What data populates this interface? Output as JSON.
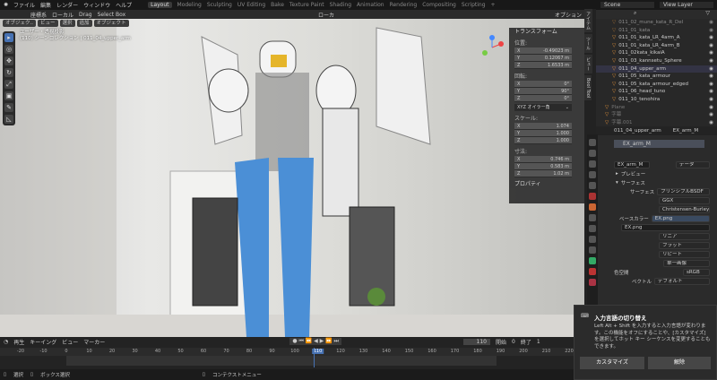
{
  "menu": [
    "ファイル",
    "編集",
    "レンダー",
    "ウィンドウ",
    "ヘルプ"
  ],
  "workspaces": [
    "Layout",
    "Modeling",
    "Sculpting",
    "UV Editing",
    "Bake",
    "Texture Paint",
    "Shading",
    "Animation",
    "Rendering",
    "Compositing",
    "Scripting",
    "+"
  ],
  "scene": "Scene",
  "view_layer": "View Layer",
  "header": {
    "orientation": "座標系",
    "pivot": "ローカル",
    "drag_label": "Drag",
    "drag_value": "Select Box",
    "snap": "ローカ",
    "options": "オプション"
  },
  "viewport": {
    "mode": "オブジェク..",
    "menus": [
      "ビュー",
      "選択",
      "追加",
      "オブジェクト"
    ],
    "view_name": "ユーザー・透視投影",
    "collection_info": "(110) シーンコレクション | 011_04_upper_arm"
  },
  "npanel": {
    "transform": "トランスフォーム",
    "location": "位置:",
    "loc": [
      "-0.49023 m",
      "0.12067 m",
      "1.6533 m"
    ],
    "rotation": "回転:",
    "rot": [
      "0°",
      "90°",
      "0°"
    ],
    "rot_mode": "XYZ オイラー角",
    "scale": "スケール:",
    "scl": [
      "1.074",
      "1.000",
      "1.000"
    ],
    "dimensions": "寸法:",
    "dim": [
      "0.746 m",
      "0.583 m",
      "1.02 m"
    ],
    "properties": "プロパティ",
    "axes": [
      "X",
      "Y",
      "Z"
    ],
    "tabs": [
      "アイテム",
      "ツール",
      "ビュー",
      "Bool Tool"
    ]
  },
  "outliner": {
    "items": [
      "011_02_mune_kata_R_Del",
      "011_01_kata",
      "011_01_kata_LR_4arm_A",
      "011_01_kata_LR_4arm_B",
      "011_02kata_kikaiA",
      "011_03_kannsetu_Sphere",
      "011_04_upper_arm",
      "011_05_kata_armour",
      "011_05_kata_armour_edged",
      "011_06_head_tuno",
      "011_10_tenohira"
    ],
    "extra": [
      "Plane",
      "字幕",
      "字幕.001"
    ]
  },
  "properties": {
    "object": "011_04_upper_arm",
    "material": "EX_arm_M",
    "slot": "EX_arm_M",
    "link": "データ",
    "preview": "プレビュー",
    "surface_section": "サーフェス",
    "surface_label": "サーフェス",
    "surface_value": "プリンシプルBSDF",
    "distribution": "GGX",
    "subsurface": "Christensen-Burley",
    "base_color_label": "ベースカラー",
    "base_color_value": "EX.png",
    "image": "EX.png",
    "interp": "リニア",
    "projection": "フラット",
    "extension": "リピート",
    "source": "単一画像",
    "colorspace_label": "色空間",
    "colorspace": "sRGB",
    "vector_label": "ベクトル",
    "vector": "デフォルト"
  },
  "timeline": {
    "menus": [
      "再生",
      "キーイング",
      "ビュー",
      "マーカー"
    ],
    "current_frame": "110",
    "start_label": "開始",
    "start": "0",
    "end_label": "終了",
    "end": "1",
    "ticks": [
      -20,
      -10,
      0,
      10,
      20,
      30,
      40,
      50,
      60,
      70,
      80,
      90,
      100,
      110,
      120,
      130,
      140,
      150,
      160,
      170,
      180,
      190,
      200,
      210,
      220
    ]
  },
  "status": [
    "選択",
    "ボックス選択",
    "コンテクストメニュー"
  ],
  "toast": {
    "title": "入力言語の切り替え",
    "body": "Left Alt + Shift を入力すると入力言語が変わります。この機能をオフにすることや、[カスタマイズ] を選択してホット キー シーケンスを変更することもできます。",
    "customize": "カスタマイズ",
    "dismiss": "解除"
  }
}
